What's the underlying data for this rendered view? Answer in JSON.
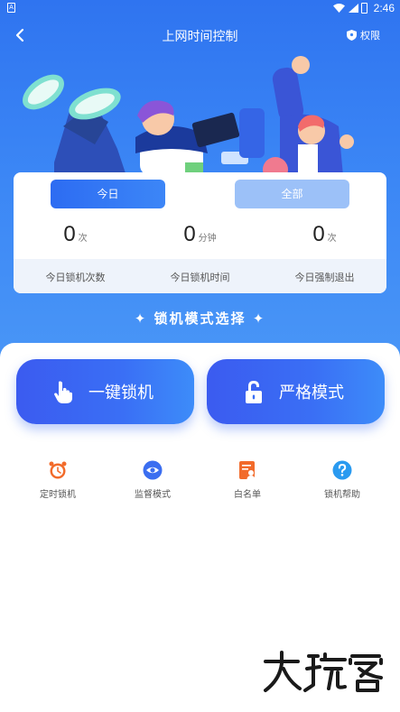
{
  "status_bar": {
    "time": "2:46",
    "sim_label": "A"
  },
  "nav": {
    "title": "上网时间控制",
    "permissions_label": "权限"
  },
  "tabs": [
    {
      "label": "今日",
      "active": true
    },
    {
      "label": "全部",
      "active": false
    }
  ],
  "stats": [
    {
      "value": "0",
      "unit": "次",
      "label": "今日锁机次数"
    },
    {
      "value": "0",
      "unit": "分钟",
      "label": "今日锁机时间"
    },
    {
      "value": "0",
      "unit": "次",
      "label": "今日强制退出"
    }
  ],
  "section": {
    "title": "✦ 锁机模式选择 ✦"
  },
  "modes": {
    "one_key": "一键锁机",
    "strict": "严格模式"
  },
  "tools": [
    {
      "label": "定时锁机",
      "icon": "alarm-clock-icon",
      "color": "#f26b2b"
    },
    {
      "label": "监督模式",
      "icon": "eye-icon",
      "color": "#3b6ef0"
    },
    {
      "label": "白名单",
      "icon": "whitelist-icon",
      "color": "#f26b2b"
    },
    {
      "label": "锁机帮助",
      "icon": "help-icon",
      "color": "#2a9af0"
    }
  ],
  "colors": {
    "primary": "#2f74f0",
    "tab_inactive": "#9cc1f8",
    "accent_orange": "#f26b2b"
  }
}
